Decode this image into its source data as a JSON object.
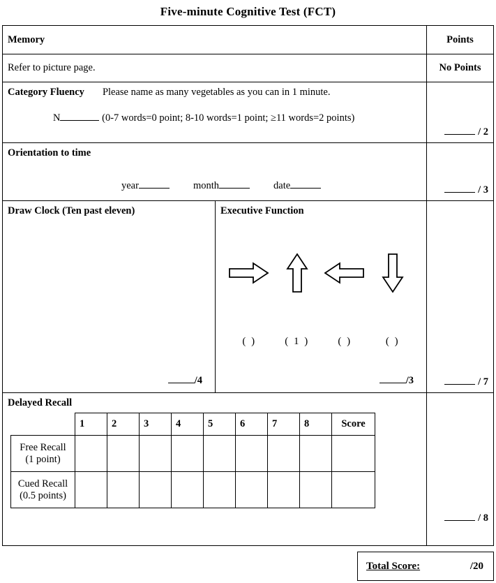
{
  "title": "Five-minute Cognitive Test (FCT)",
  "points_column": {
    "header": "Points",
    "no_points": "No Points"
  },
  "sections": {
    "memory": {
      "title": "Memory",
      "instruction": "Refer to picture page."
    },
    "category_fluency": {
      "title": "Category Fluency",
      "prompt": "Please name as many vegetables as you can in 1 minute.",
      "answer_prefix": "N",
      "scoring_note": "(0-7 words=0 point; 8-10 words=1 point; ≥11 words=2 points)",
      "points": "/ 2"
    },
    "orientation": {
      "title": "Orientation to time",
      "fields": [
        "year",
        "month",
        "date"
      ],
      "points": "/ 3"
    },
    "draw_clock": {
      "title": "Draw Clock (Ten past eleven)",
      "points": "/4"
    },
    "executive_function": {
      "title": "Executive Function",
      "arrows": [
        {
          "name": "arrow-right",
          "direction": "right"
        },
        {
          "name": "arrow-up",
          "direction": "up"
        },
        {
          "name": "arrow-left",
          "direction": "left"
        },
        {
          "name": "arrow-down",
          "direction": "down"
        }
      ],
      "answers": [
        "(   )",
        "( 1 )",
        "(   )",
        "(   )"
      ],
      "points": "/3"
    },
    "clock_executive_points": "/ 7",
    "delayed_recall": {
      "title": "Delayed Recall",
      "columns": [
        "",
        "1",
        "2",
        "3",
        "4",
        "5",
        "6",
        "7",
        "8",
        "Score"
      ],
      "rows": [
        {
          "label": "Free Recall",
          "sublabel": "(1 point)",
          "cells": [
            "",
            "",
            "",
            "",
            "",
            "",
            "",
            "",
            ""
          ]
        },
        {
          "label": "Cued Recall",
          "sublabel": "(0.5 points)",
          "cells": [
            "",
            "",
            "",
            "",
            "",
            "",
            "",
            "",
            ""
          ]
        }
      ],
      "points": "/ 8"
    }
  },
  "total": {
    "label": "Total Score:",
    "max": "/20"
  }
}
